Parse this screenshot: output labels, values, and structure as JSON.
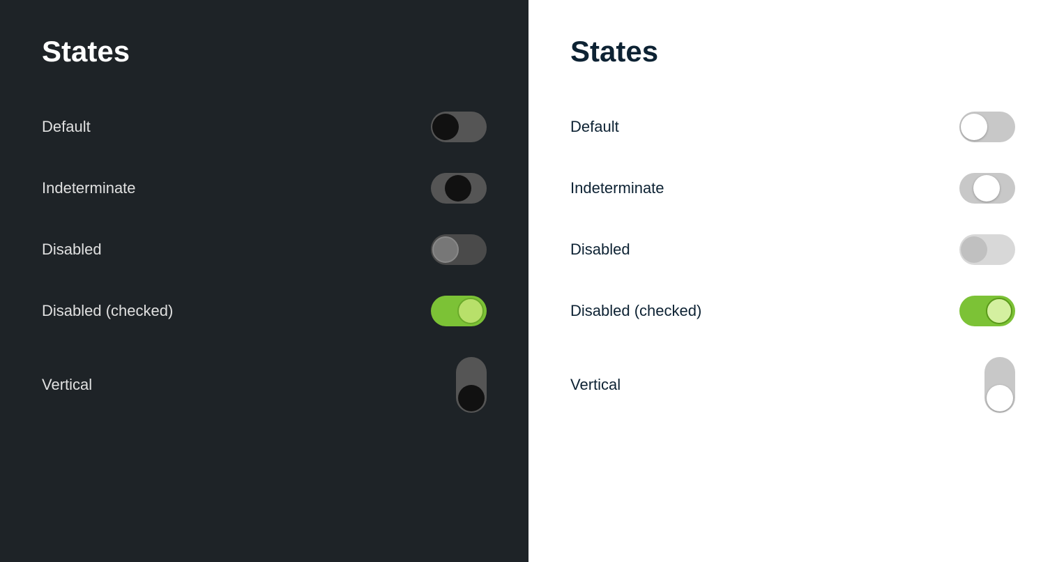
{
  "dark_panel": {
    "title": "States",
    "rows": [
      {
        "id": "default",
        "label": "Default"
      },
      {
        "id": "indeterminate",
        "label": "Indeterminate"
      },
      {
        "id": "disabled",
        "label": "Disabled"
      },
      {
        "id": "disabled-checked",
        "label": "Disabled (checked)"
      },
      {
        "id": "vertical",
        "label": "Vertical"
      }
    ]
  },
  "light_panel": {
    "title": "States",
    "rows": [
      {
        "id": "default",
        "label": "Default"
      },
      {
        "id": "indeterminate",
        "label": "Indeterminate"
      },
      {
        "id": "disabled",
        "label": "Disabled"
      },
      {
        "id": "disabled-checked",
        "label": "Disabled (checked)"
      },
      {
        "id": "vertical",
        "label": "Vertical"
      }
    ]
  }
}
